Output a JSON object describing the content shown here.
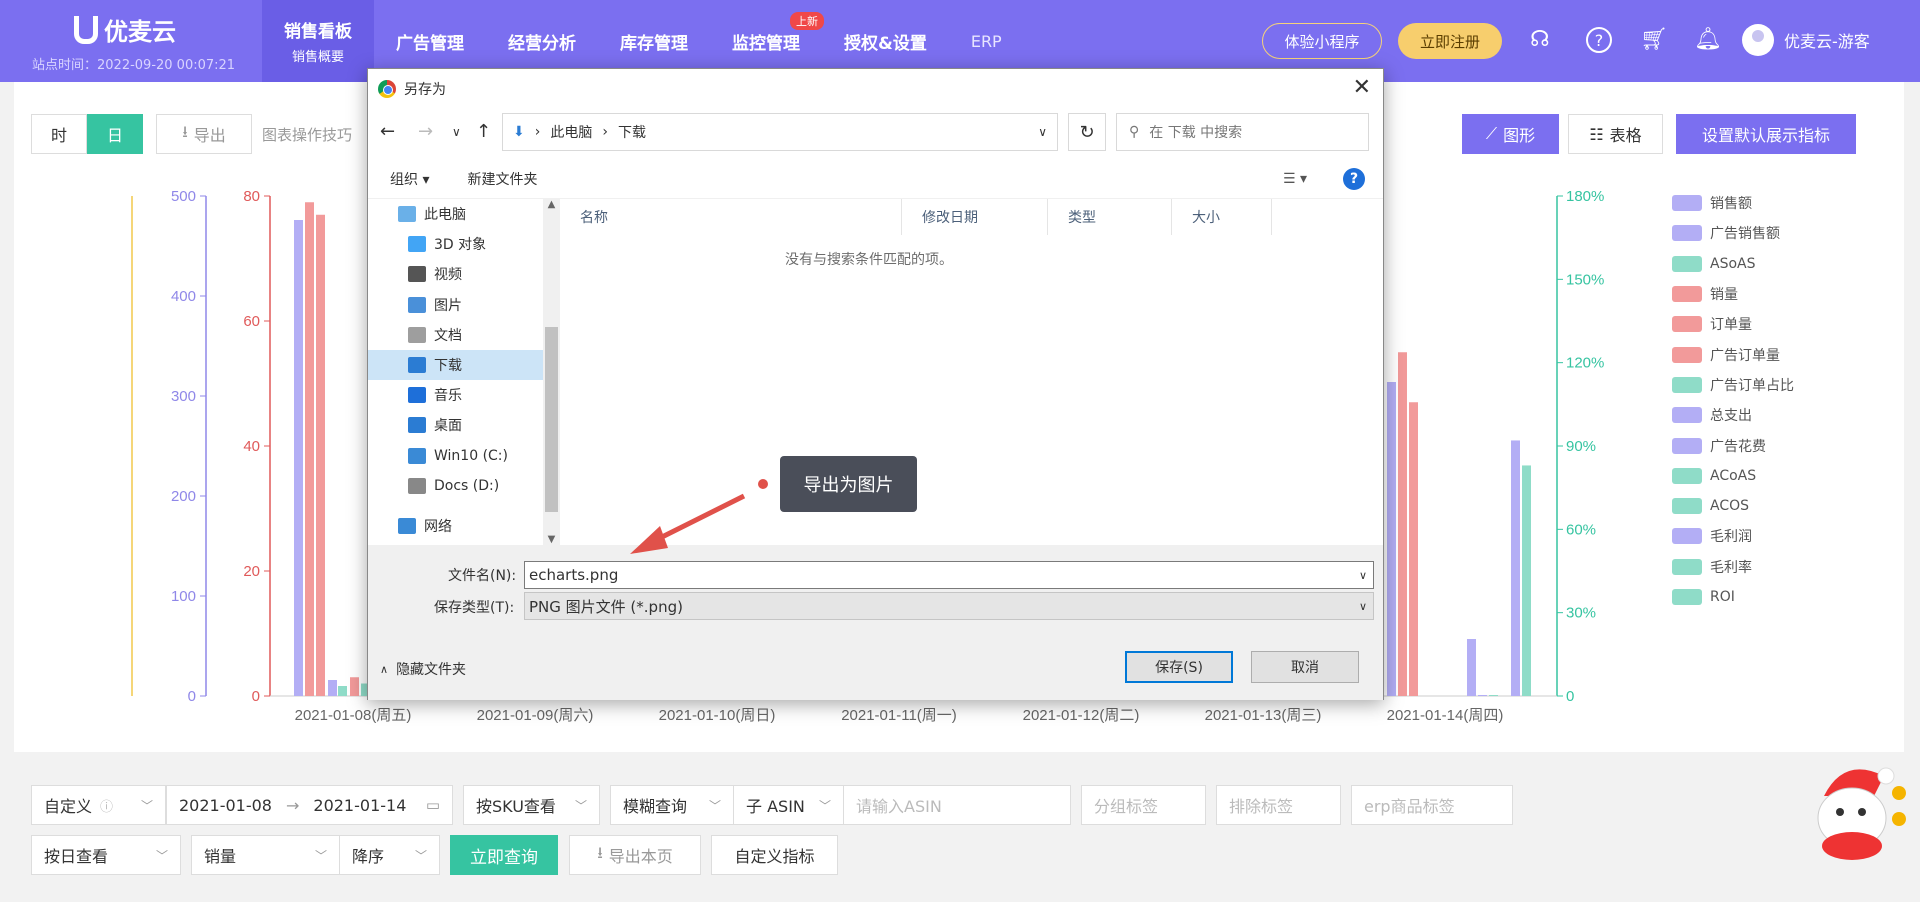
{
  "topnav": {
    "logo_text": "优麦云",
    "site_time": "站点时间：2022-09-20 00:07:21",
    "items": [
      {
        "label": "销售看板",
        "sub": "销售概要",
        "active": true
      },
      {
        "label": "广告管理"
      },
      {
        "label": "经营分析"
      },
      {
        "label": "库存管理"
      },
      {
        "label": "监控管理",
        "badge": "上新"
      },
      {
        "label": "授权&设置"
      },
      {
        "label": "ERP"
      }
    ],
    "mini_program": "体验小程序",
    "register": "立即注册",
    "user": "优麦云-游客"
  },
  "toolbar": {
    "seg_hour": "时",
    "seg_day": "日",
    "export": "导出",
    "tips": "图表操作技巧",
    "graph_btn": "图形",
    "table_btn": "表格",
    "default_btn": "设置默认展示指标"
  },
  "chart_data": {
    "type": "bar",
    "categories": [
      "2021-01-08(周五)",
      "2021-01-09(周六)",
      "2021-01-10(周日)",
      "2021-01-11(周一)",
      "2021-01-12(周二)",
      "2021-01-13(周三)",
      "2021-01-14(周四)"
    ],
    "axes": {
      "left1": {
        "ticks": [
          "0",
          "100",
          "200",
          "300",
          "400",
          "500"
        ],
        "color": "#8f87e8"
      },
      "left2": {
        "ticks": [
          "0",
          "20",
          "40",
          "60",
          "80"
        ],
        "color": "#e05a5a"
      },
      "right": {
        "ticks": [
          "0",
          "30%",
          "60%",
          "90%",
          "120%",
          "150%",
          "180%"
        ],
        "color": "#36c4a1"
      }
    },
    "legend": [
      {
        "name": "销售额",
        "color": "#b3aef5"
      },
      {
        "name": "广告销售额",
        "color": "#b3aef5"
      },
      {
        "name": "ASoAS",
        "color": "#8fdcc8"
      },
      {
        "name": "销量",
        "color": "#f29a9a"
      },
      {
        "name": "订单量",
        "color": "#f29a9a"
      },
      {
        "name": "广告订单量",
        "color": "#f29a9a"
      },
      {
        "name": "广告订单占比",
        "color": "#8fdcc8"
      },
      {
        "name": "总支出",
        "color": "#b3aef5"
      },
      {
        "name": "广告花费",
        "color": "#b3aef5"
      },
      {
        "name": "ACoAS",
        "color": "#8fdcc8"
      },
      {
        "name": "ACOS",
        "color": "#8fdcc8"
      },
      {
        "name": "毛利润",
        "color": "#b3aef5"
      },
      {
        "name": "毛利率",
        "color": "#8fdcc8"
      },
      {
        "name": "ROI",
        "color": "#8fdcc8"
      }
    ],
    "visible_bars": [
      {
        "category": "2021-01-08(周五)",
        "sales": 476,
        "units": 79,
        "orders": 77,
        "misc": [
          16,
          10,
          3,
          2
        ]
      },
      {
        "category": "2021-01-13(周三)",
        "sales": 314,
        "units": 55,
        "orders": 47
      },
      {
        "category": "2021-01-14(周四)",
        "sales": 57,
        "misc": [
          1,
          1
        ],
        "percent_bars": [
          "92%",
          "83%"
        ]
      }
    ]
  },
  "filters": {
    "custom": "自定义",
    "date_from": "2021-01-08",
    "date_to": "2021-01-14",
    "by_sku": "按SKU查看",
    "fuzzy": "模糊查询",
    "sub_asin": "子 ASIN",
    "asin_placeholder": "请输入ASIN",
    "group_tag": "分组标签",
    "exclude_tag": "排除标签",
    "erp_tag": "erp商品标签",
    "by_day": "按日查看",
    "metric": "销量",
    "order": "降序",
    "query": "立即查询",
    "export_page": "导出本页",
    "custom_metric": "自定义指标"
  },
  "dialog": {
    "title": "另存为",
    "path": [
      "此电脑",
      "下载"
    ],
    "search_placeholder": "在 下载 中搜索",
    "organize": "组织",
    "new_folder": "新建文件夹",
    "tree": [
      {
        "label": "此电脑",
        "root": true
      },
      {
        "label": "3D 对象"
      },
      {
        "label": "视频"
      },
      {
        "label": "图片"
      },
      {
        "label": "文档"
      },
      {
        "label": "下载",
        "selected": true
      },
      {
        "label": "音乐"
      },
      {
        "label": "桌面"
      },
      {
        "label": "Win10 (C:)"
      },
      {
        "label": "Docs (D:)"
      },
      {
        "label": "网络",
        "root": true
      }
    ],
    "columns": [
      "名称",
      "修改日期",
      "类型",
      "大小"
    ],
    "empty_text": "没有与搜索条件匹配的项。",
    "filename_label": "文件名(N):",
    "filename": "echarts.png",
    "filetype_label": "保存类型(T):",
    "filetype": "PNG 图片文件 (*.png)",
    "hide_folders": "隐藏文件夹",
    "save": "保存(S)",
    "cancel": "取消"
  },
  "callout": "导出为图片"
}
